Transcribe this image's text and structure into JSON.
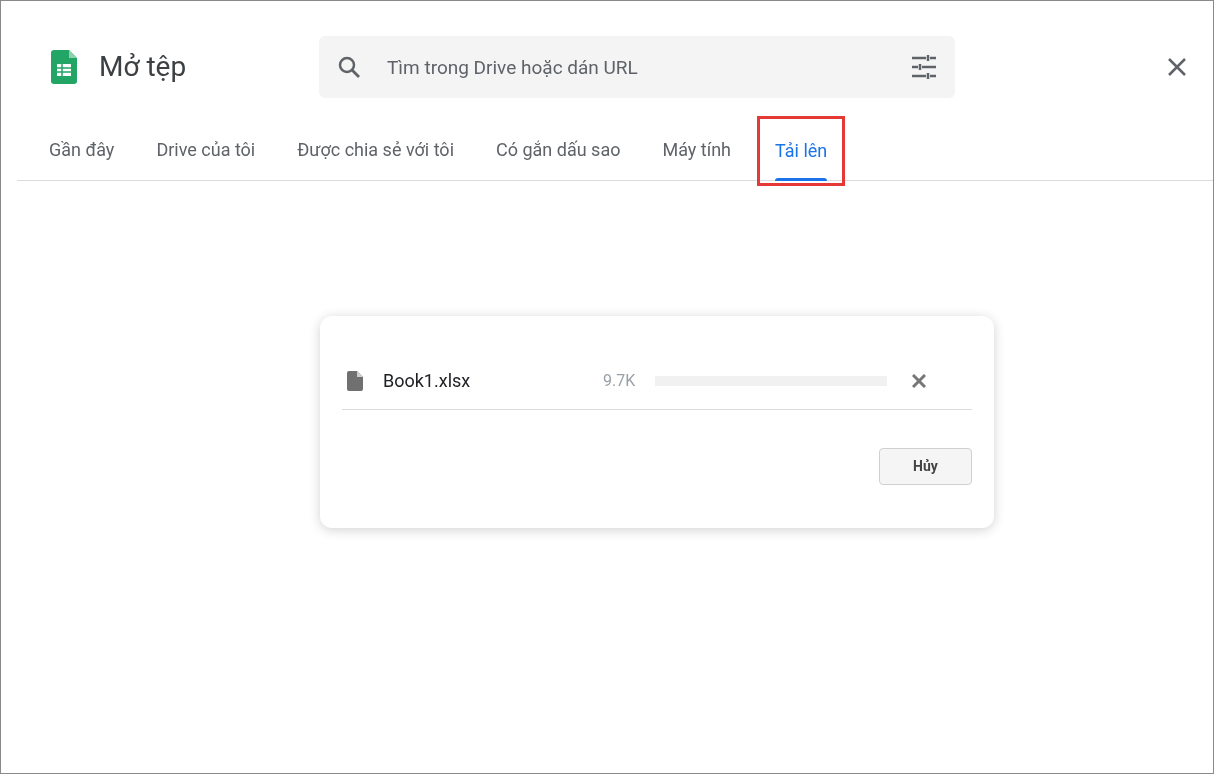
{
  "header": {
    "title": "Mở tệp",
    "search": {
      "placeholder": "Tìm trong Drive hoặc dán URL"
    }
  },
  "tabs": [
    {
      "label": "Gần đây",
      "selected": false,
      "highlighted": false
    },
    {
      "label": "Drive của tôi",
      "selected": false,
      "highlighted": false
    },
    {
      "label": "Được chia sẻ với tôi",
      "selected": false,
      "highlighted": false
    },
    {
      "label": "Có gắn dấu sao",
      "selected": false,
      "highlighted": false
    },
    {
      "label": "Máy tính",
      "selected": false,
      "highlighted": false
    },
    {
      "label": "Tải lên",
      "selected": true,
      "highlighted": true
    }
  ],
  "upload_dialog": {
    "files": [
      {
        "name": "Book1.xlsx",
        "size": "9.7K",
        "level": 0
      }
    ],
    "cancel_button": "Hủy"
  }
}
